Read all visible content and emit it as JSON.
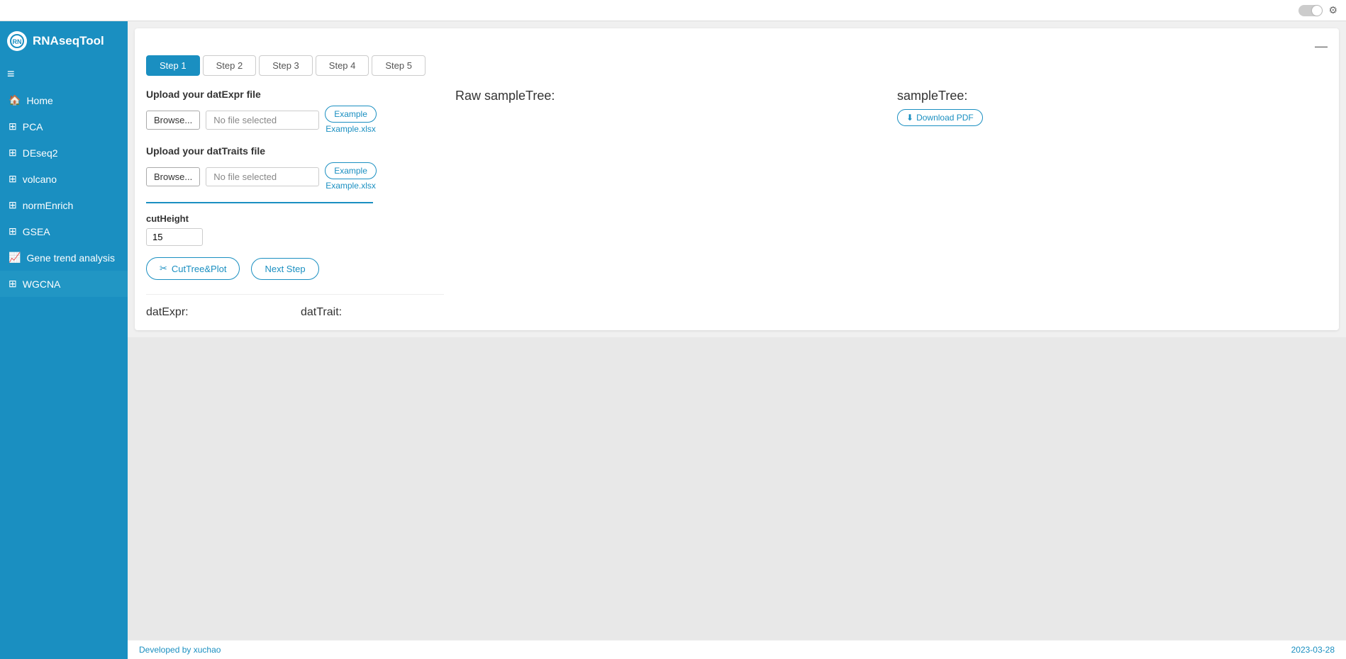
{
  "app": {
    "title": "RNAseqTool",
    "logo_text": "RN"
  },
  "topbar": {
    "toggle_state": "off",
    "gear_label": "⚙"
  },
  "sidebar": {
    "hamburger": "≡",
    "items": [
      {
        "id": "home",
        "label": "Home",
        "icon": "🏠",
        "active": false
      },
      {
        "id": "pca",
        "label": "PCA",
        "icon": "⊞",
        "active": false
      },
      {
        "id": "deseq2",
        "label": "DEseq2",
        "icon": "⊞",
        "active": false
      },
      {
        "id": "volcano",
        "label": "volcano",
        "icon": "⊞",
        "active": false
      },
      {
        "id": "normenrich",
        "label": "normEnrich",
        "icon": "⊞",
        "active": false
      },
      {
        "id": "gsea",
        "label": "GSEA",
        "icon": "⊞",
        "active": false
      },
      {
        "id": "gene-trend",
        "label": "Gene trend analysis",
        "icon": "📈",
        "active": false
      },
      {
        "id": "wgcna",
        "label": "WGCNA",
        "icon": "⊞",
        "active": true
      }
    ]
  },
  "steps": {
    "tabs": [
      {
        "label": "Step 1",
        "active": true
      },
      {
        "label": "Step 2",
        "active": false
      },
      {
        "label": "Step 3",
        "active": false
      },
      {
        "label": "Step 4",
        "active": false
      },
      {
        "label": "Step 5",
        "active": false
      }
    ]
  },
  "upload_datexpr": {
    "label": "Upload your datExpr file",
    "browse_label": "Browse...",
    "file_placeholder": "No file selected",
    "example_btn": "Example",
    "example_link": "Example.xlsx"
  },
  "upload_dattraits": {
    "label": "Upload your datTraits file",
    "browse_label": "Browse...",
    "file_placeholder": "No file selected",
    "example_btn": "Example",
    "example_link": "Example.xlsx"
  },
  "cutheight": {
    "label": "cutHeight",
    "value": "15"
  },
  "buttons": {
    "cut_tree": "CutTree&Plot",
    "cut_tree_icon": "✂",
    "next_step": "Next Step"
  },
  "raw_sample_tree": {
    "title": "Raw sampleTree:"
  },
  "sample_tree": {
    "title": "sampleTree:",
    "download_pdf": "Download PDF"
  },
  "data_display": {
    "datexpr_label": "datExpr:",
    "dattrait_label": "datTrait:"
  },
  "footer": {
    "left": "Developed by xuchao",
    "right": "2023-03-28"
  }
}
